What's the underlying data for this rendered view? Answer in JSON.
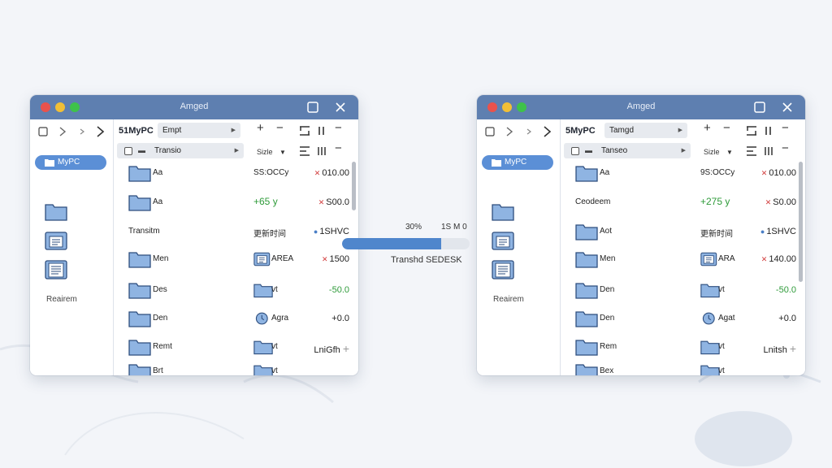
{
  "windows": [
    {
      "title": "Amged",
      "sidebar": {
        "selected_item": "MyPC",
        "label": "Reairem"
      },
      "path": "51MyPC",
      "combo1": "Empt",
      "combo2": "Transio",
      "size_label": "Sizle",
      "rows": [
        {
          "name": "Aa",
          "mid": "SS:OCCy",
          "mid_kind": "text",
          "val": "010.00",
          "mark": "✕",
          "mark_color": "red"
        },
        {
          "name": "Aa",
          "mid": "+65 y",
          "mid_kind": "green",
          "val": "S00.0",
          "mark": "✕",
          "mark_color": "red"
        },
        {
          "name": "Transitm",
          "wide": true,
          "mid": "更新时间",
          "mid_kind": "text",
          "val": "1SHVC",
          "mark": "●",
          "mark_color": "blue"
        },
        {
          "name": "Men",
          "mid": "AREA",
          "mid_kind": "icon-doc",
          "val": "1500",
          "mark": "✕",
          "mark_color": "red"
        },
        {
          "name": "Des",
          "mid": "vt",
          "mid_kind": "icon-folder",
          "val": "-50.0",
          "val_color": "green"
        },
        {
          "name": "Den",
          "mid": "Agra",
          "mid_kind": "icon-clock",
          "val": "+0.0"
        },
        {
          "name": "Remt",
          "mid": "vt",
          "mid_kind": "icon-folder",
          "val": "LniGfh",
          "plus": true
        },
        {
          "name": "Brt",
          "mid": "vt",
          "mid_kind": "icon-folder",
          "val": ""
        }
      ]
    },
    {
      "title": "Amged",
      "sidebar": {
        "selected_item": "MyPC",
        "label": "Reairem"
      },
      "path": "5MyPC",
      "combo1": "Tamgd",
      "combo2": "Tanseo",
      "size_label": "Sizle",
      "rows": [
        {
          "name": "Aa",
          "mid": "9S:OCCy",
          "mid_kind": "text",
          "val": "010.00",
          "mark": "✕",
          "mark_color": "red"
        },
        {
          "name": "Ceodeem",
          "wide": true,
          "mid": "+275 y",
          "mid_kind": "green",
          "val": "S0.00",
          "mark": "✕",
          "mark_color": "red"
        },
        {
          "name": "Aot",
          "mid": "更新时间",
          "mid_kind": "text",
          "val": "1SHVC",
          "mark": "●",
          "mark_color": "blue"
        },
        {
          "name": "Men",
          "mid": "ARA",
          "mid_kind": "icon-doc",
          "val": "140.00",
          "mark": "✕",
          "mark_color": "red"
        },
        {
          "name": "Den",
          "mid": "vt",
          "mid_kind": "icon-folder",
          "val": "-50.0",
          "val_color": "green"
        },
        {
          "name": "Den",
          "mid": "Agat",
          "mid_kind": "icon-clock",
          "val": "+0.0"
        },
        {
          "name": "Rem",
          "mid": "vt",
          "mid_kind": "icon-folder",
          "val": "Lnitsh",
          "plus": true
        },
        {
          "name": "Bex",
          "mid": "vt",
          "mid_kind": "icon-folder",
          "val": ""
        }
      ]
    }
  ],
  "transfer": {
    "percent_label": "30%",
    "size_label": "1S M 0",
    "progress": 0.78,
    "label": "Transhd SEDESK"
  },
  "colors": {
    "titlebar": "#5e7fb0",
    "accent": "#5b8fd6",
    "progress": "#4f86cc",
    "positive": "#2f9b3a",
    "negative": "#d23c3c"
  },
  "icons": [
    "close-icon",
    "maximize-icon",
    "folder-icon",
    "document-icon",
    "clock-icon",
    "back-icon",
    "forward-icon",
    "plus-icon",
    "minus-icon",
    "pause-icon",
    "list-icon"
  ]
}
